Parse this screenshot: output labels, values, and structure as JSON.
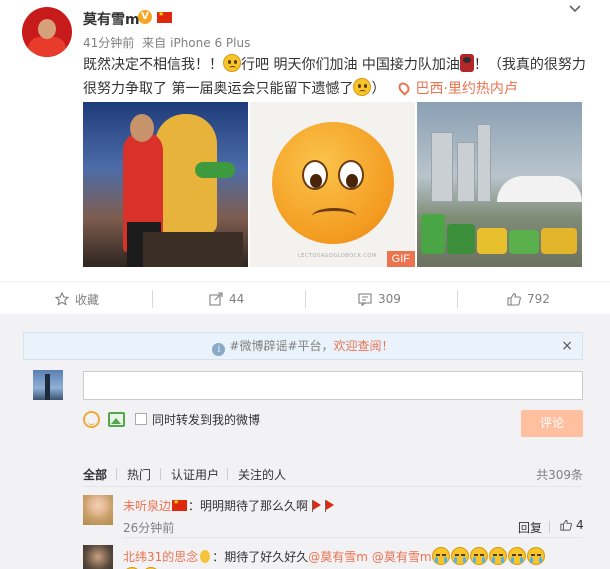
{
  "post": {
    "username": "莫有雪m",
    "vip_badge": "V",
    "time": "41分钟前",
    "source_prefix": "来自",
    "source": "iPhone 6 Plus",
    "text_part1": "既然决定不相信我！！",
    "text_part2": "行吧 明天你们加油 中国接力队加油",
    "text_part3": "！（我真的很努力很努力争取了 第一届奥运会只能留下遗憾了",
    "text_part4": "）",
    "location": "巴西·里约热内卢",
    "gif_label": "GIF",
    "watermark": "LECTOSAGOGLOBOCK.COM"
  },
  "actions": {
    "favorite_label": "收藏",
    "forward_count": "44",
    "comment_count": "309",
    "like_count": "792"
  },
  "notice": {
    "prefix": "#微博辟谣#平台，",
    "link": "欢迎查阅！",
    "close": "×"
  },
  "comment_box": {
    "forward_label": "同时转发到我的微博",
    "submit_label": "评论",
    "input_value": ""
  },
  "filters": {
    "all": "全部",
    "hot": "热门",
    "verified": "认证用户",
    "following": "关注的人",
    "total": "共309条"
  },
  "comments": [
    {
      "name": "未听泉边",
      "text": "：明明期待了那么久啊",
      "time": "26分钟前",
      "reply_label": "回复",
      "likes": "4"
    },
    {
      "name": "北纬31的思念",
      "text": "：期待了好久好久",
      "mention1": "@莫有雪m",
      "mention2": "@莫有雪m"
    }
  ],
  "icons": {
    "dropdown": "chevron-down-icon",
    "favorite": "star-outline-icon",
    "forward": "forward-icon",
    "comment": "comment-icon",
    "like": "thumbs-up-icon",
    "location": "location-pin-icon",
    "info": "info-icon",
    "emoji": "smile-icon",
    "image": "image-icon"
  },
  "colors": {
    "accent": "#eb7350",
    "submit_disabled": "#ffc09f",
    "link_blue": "#eb7350"
  }
}
